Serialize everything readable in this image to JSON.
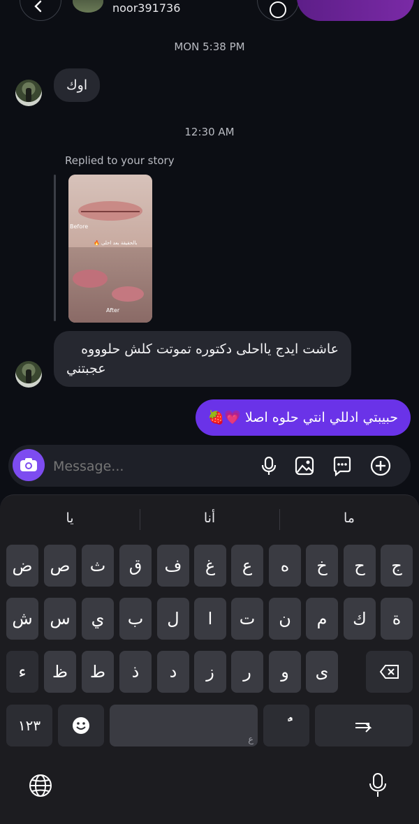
{
  "header": {
    "username": "noor391736"
  },
  "thread": {
    "timestamp_1": "MON 5:38 PM",
    "msg_1": "اوك",
    "timestamp_2": "12:30 AM",
    "reply_label": "Replied to your story",
    "story_before": "Before",
    "story_after": "After",
    "story_overlay_text": "بالحقيقة بعد احلى 🔥",
    "msg_2_line1": "عاشت ايدج يااحلى دكتوره تموتت كلش حلوووه",
    "msg_2_line2": "عجبتني",
    "msg_3": "حبيبتي ادللي انتي حلوه اصلا 💗🍓"
  },
  "composer": {
    "placeholder": "Message..."
  },
  "keyboard": {
    "suggestions": [
      "يا",
      "أنا",
      "ما"
    ],
    "row1": [
      "ض",
      "ص",
      "ث",
      "ق",
      "ف",
      "غ",
      "ع",
      "ه",
      "خ",
      "ح",
      "ج"
    ],
    "row2": [
      "ش",
      "س",
      "ي",
      "ب",
      "ل",
      "ا",
      "ت",
      "ن",
      "م",
      "ك",
      "ة"
    ],
    "row3": [
      "ء",
      "ظ",
      "ط",
      "ذ",
      "د",
      "ز",
      "ر",
      "و",
      "ى"
    ],
    "numbers_key": "١٢٣",
    "space_hint": "ع",
    "diacritic_key": "ًٌ"
  },
  "colors": {
    "accent": "#6a33e8",
    "background": "#0c0e14",
    "incoming_bubble": "#262830"
  }
}
